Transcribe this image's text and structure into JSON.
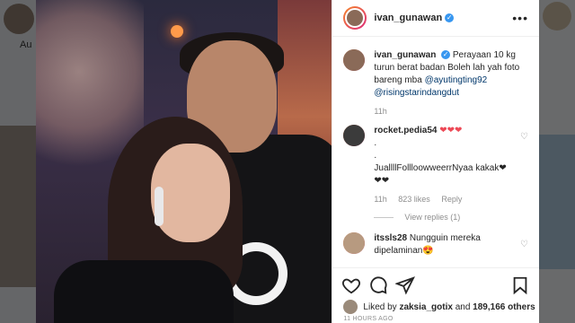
{
  "background": {
    "left_label": "Au"
  },
  "post": {
    "username": "ivan_gunawan",
    "verified_mark": "✓",
    "more_label": "•••"
  },
  "caption": {
    "username": "ivan_gunawan",
    "text": "Perayaan 10 kg turun berat badan Boleh lah yah foto bareng mba ",
    "mention1": "@ayutingting92",
    "mention2": "@risingstarindangdut",
    "time": "11h"
  },
  "comments": [
    {
      "username": "rocket.pedia54",
      "line1": "❤❤❤",
      "line2": ".",
      "line3": ".",
      "line4": "JuallllFollloowweerrNyaa kakak❤",
      "line5": "❤❤",
      "time": "11h",
      "likes": "823 likes",
      "reply": "Reply",
      "view_replies": "View replies (1)"
    },
    {
      "username": "itssls28",
      "text": "Nungguin mereka dipelaminan",
      "emoji": "😍"
    }
  ],
  "likes": {
    "prefix": "Liked by",
    "user": "zaksia_gotix",
    "and": "and",
    "count": "189,166 others"
  },
  "timestamp": "11 HOURS AGO",
  "colors": {
    "accent": "#3897f0",
    "heart": "#ed4956",
    "link": "#00376b"
  }
}
